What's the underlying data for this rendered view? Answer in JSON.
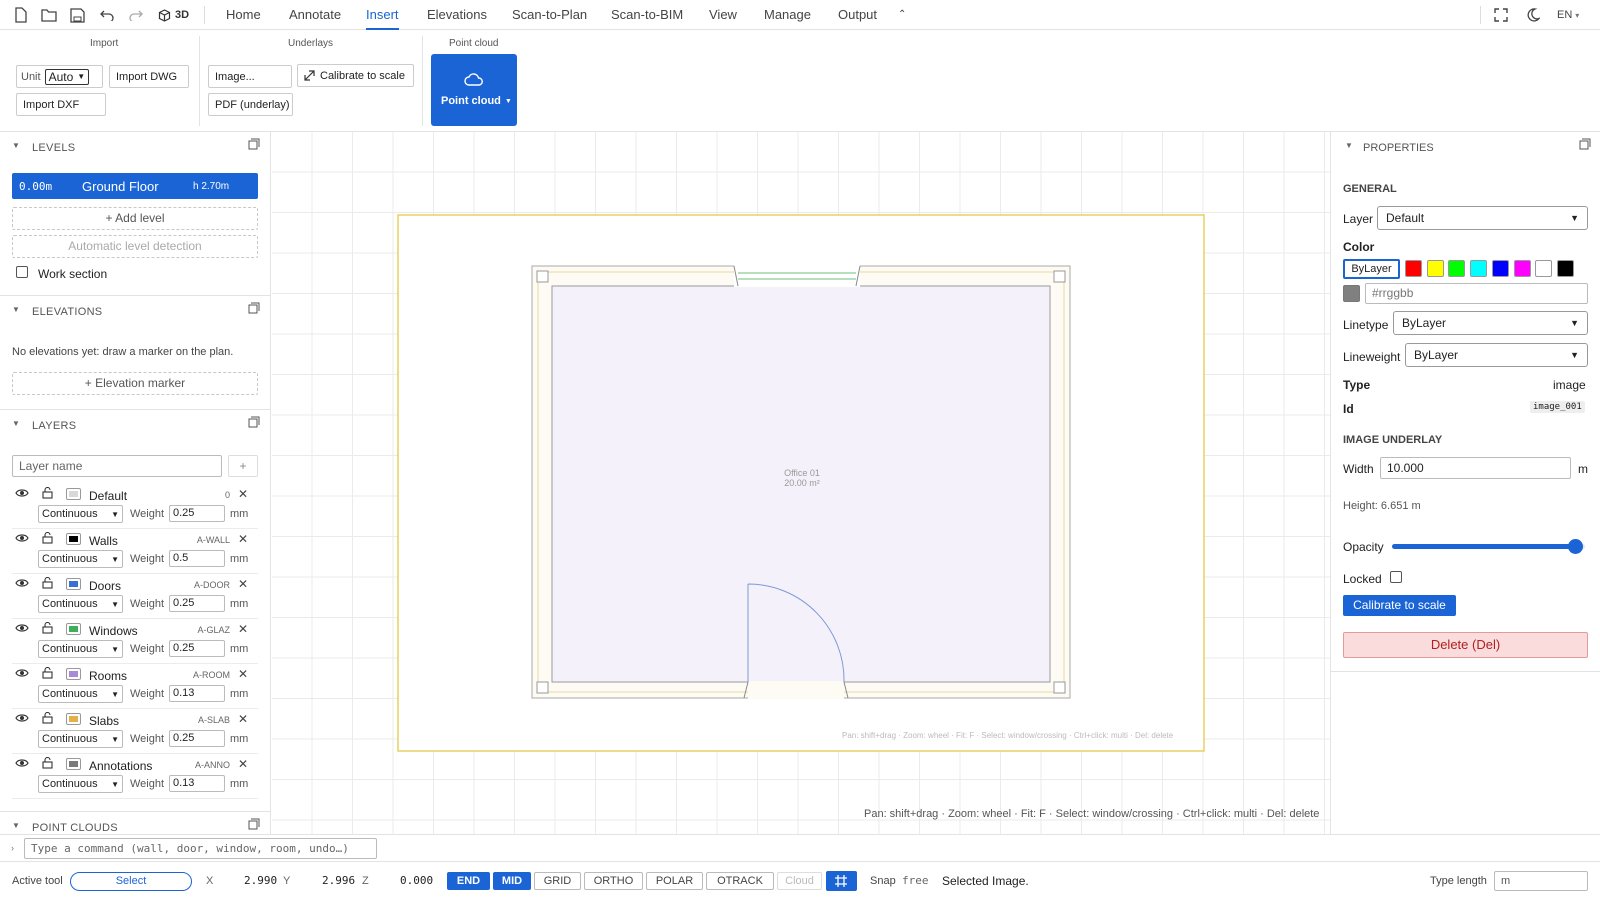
{
  "topbar": {
    "btn_3d": "3D",
    "menu": [
      "Home",
      "Annotate",
      "Insert",
      "Elevations",
      "Scan-to-Plan",
      "Scan-to-BIM",
      "View",
      "Manage",
      "Output"
    ],
    "active_tab": "Insert",
    "lang": "EN"
  },
  "ribbon": {
    "import": {
      "title": "Import",
      "unit_label": "Unit",
      "unit_value": "Auto",
      "import_dwg": "Import DWG",
      "import_dxf": "Import DXF"
    },
    "underlays": {
      "title": "Underlays",
      "image": "Image...",
      "calibrate": "Calibrate to scale",
      "pdf": "PDF (underlay)"
    },
    "pointcloud": {
      "title": "Point cloud",
      "button": "Point cloud"
    }
  },
  "levels": {
    "title": "LEVELS",
    "active": {
      "elev": "0.00m",
      "name": "Ground Floor",
      "height": "h 2.70m"
    },
    "add": "+ Add level",
    "auto": "Automatic level detection",
    "work_section": "Work section"
  },
  "elevations": {
    "title": "ELEVATIONS",
    "empty": "No elevations yet: draw a marker on the plan.",
    "add": "+ Elevation marker"
  },
  "layers": {
    "title": "LAYERS",
    "input_placeholder": "Layer name",
    "add": "+",
    "weight_label": "Weight",
    "unit": "mm",
    "items": [
      {
        "name": "Default",
        "code": "0",
        "linetype": "Continuous",
        "weight": "0.25",
        "color": "#d8d8d8"
      },
      {
        "name": "Walls",
        "code": "A-WALL",
        "linetype": "Continuous",
        "weight": "0.5",
        "color": "#000000"
      },
      {
        "name": "Doors",
        "code": "A-DOOR",
        "linetype": "Continuous",
        "weight": "0.25",
        "color": "#3b6fd4"
      },
      {
        "name": "Windows",
        "code": "A-GLAZ",
        "linetype": "Continuous",
        "weight": "0.25",
        "color": "#3fae5b"
      },
      {
        "name": "Rooms",
        "code": "A-ROOM",
        "linetype": "Continuous",
        "weight": "0.13",
        "color": "#a88ad8"
      },
      {
        "name": "Slabs",
        "code": "A-SLAB",
        "linetype": "Continuous",
        "weight": "0.25",
        "color": "#e3b04a"
      },
      {
        "name": "Annotations",
        "code": "A-ANNO",
        "linetype": "Continuous",
        "weight": "0.13",
        "color": "#7a7a7a"
      }
    ]
  },
  "pointclouds": {
    "title": "POINT CLOUDS"
  },
  "canvas": {
    "room_label": "Office 01",
    "room_area": "20.00 m²",
    "hint_inner": "Pan: shift+drag · Zoom: wheel · Fit: F · Select: window/crossing · Ctrl+click: multi · Del: delete",
    "hint": "Pan: shift+drag · Zoom: wheel · Fit: F · Select: window/crossing · Ctrl+click: multi · Del: delete"
  },
  "properties": {
    "title": "PROPERTIES",
    "general": "GENERAL",
    "layer_label": "Layer",
    "layer_value": "Default",
    "color_label": "Color",
    "color_bylayer": "ByLayer",
    "swatches": [
      "#ff0000",
      "#ffff00",
      "#00ff00",
      "#00ffff",
      "#0000ff",
      "#ff00ff",
      "#ffffff",
      "#000000"
    ],
    "hex_placeholder": "#rrggbb",
    "linetype_label": "Linetype",
    "linetype_value": "ByLayer",
    "lineweight_label": "Lineweight",
    "lineweight_value": "ByLayer",
    "type_label": "Type",
    "type_value": "image",
    "id_label": "Id",
    "id_value": "image_001",
    "underlay_title": "IMAGE UNDERLAY",
    "width_label": "Width",
    "width_value": "10.000",
    "width_unit": "m",
    "height_text": "Height: 6.651 m",
    "opacity_label": "Opacity",
    "opacity_value": 0.95,
    "locked_label": "Locked",
    "calibrate": "Calibrate to scale",
    "delete": "Delete (Del)"
  },
  "command": {
    "placeholder": "Type a command (wall, door, window, room, undo…)"
  },
  "status": {
    "active_tool_label": "Active tool",
    "active_tool": "Select",
    "x_label": "X",
    "x": "2.990",
    "y_label": "Y",
    "y": "2.996",
    "z_label": "Z",
    "z": "0.000",
    "toggles": [
      "END",
      "MID",
      "GRID",
      "ORTHO",
      "POLAR",
      "OTRACK",
      "Cloud"
    ],
    "snap_label": "Snap",
    "snap_value": "free",
    "message": "Selected Image.",
    "type_length_label": "Type length",
    "type_length_value": "m"
  }
}
